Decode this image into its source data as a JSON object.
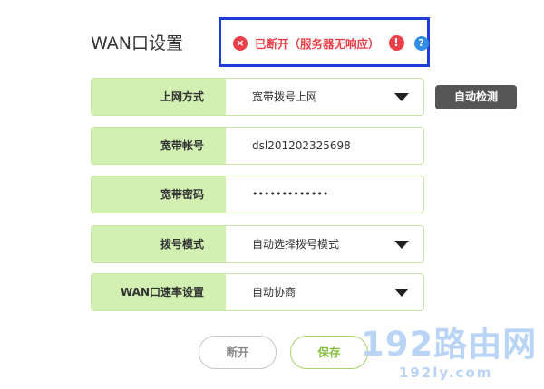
{
  "page": {
    "title": "WAN口设置"
  },
  "status": {
    "error_icon": "×",
    "text": "已断开（服务器无响应）",
    "warning_icon": "!",
    "help_icon": "?",
    "colors": {
      "error": "#ea3f49",
      "help": "#2e8de0",
      "highlight_border": "#1f3cd8"
    }
  },
  "form": {
    "connection_type": {
      "label": "上网方式",
      "value": "宽带拨号上网"
    },
    "account": {
      "label": "宽带帐号",
      "value": "dsl201202325698"
    },
    "password": {
      "label": "宽带密码",
      "value": "•••••••••••••"
    },
    "dial_mode": {
      "label": "拨号模式",
      "value": "自动选择拨号模式"
    },
    "wan_speed": {
      "label": "WAN口速率设置",
      "value": "自动协商"
    }
  },
  "buttons": {
    "auto_detect": "自动检测",
    "disconnect": "断开",
    "save": "保存"
  },
  "watermark": {
    "main": "192路由网",
    "sub": "192ly.com"
  },
  "colors": {
    "label_bg": "#d2f0b2",
    "accent_green": "#88c03e"
  }
}
